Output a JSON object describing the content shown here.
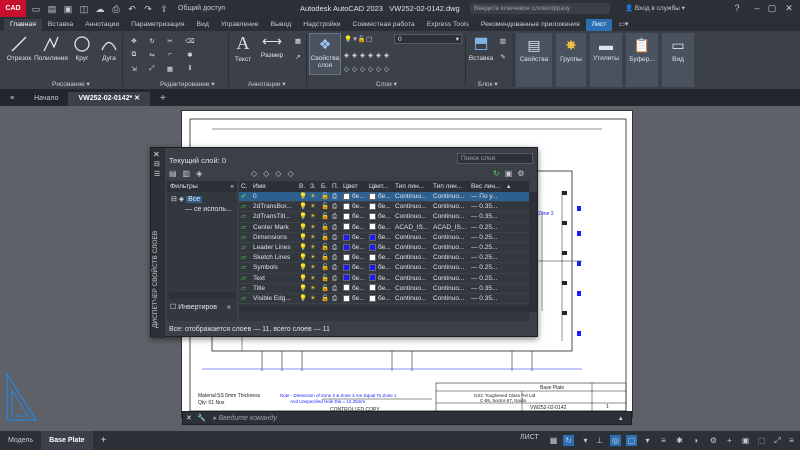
{
  "titlebar": {
    "app_badge": "CAD",
    "share_label": "Общий доступ",
    "title": "Autodesk AutoCAD 2023",
    "filename": "VW252-02-0142.dwg",
    "search_placeholder": "Введите ключевое слово/фразу",
    "sign_in": "Вход в службы"
  },
  "ribbon_tabs": [
    "Главная",
    "Вставка",
    "Аннотации",
    "Параметризация",
    "Вид",
    "Управление",
    "Вывод",
    "Надстройки",
    "Совместная работа",
    "Express Tools",
    "Рекомендованные приложения",
    "Лист"
  ],
  "ribbon": {
    "draw_tools": [
      "Отрезок",
      "Полилиния",
      "Круг",
      "Дуга"
    ],
    "panel_draw": "Рисование ▾",
    "panel_modify": "Редактирование ▾",
    "text_tool": "Текст",
    "dim_tool": "Размер",
    "panel_annot": "Аннотации ▾",
    "layer_props": "Свойства слоя",
    "layer_combo": "0",
    "panel_layers": "Слои ▾",
    "insert_tool": "Вставка",
    "panel_block": "Блок ▾",
    "props_tool": "Свойства",
    "groups_tool": "Группы",
    "utils_tool": "Утилиты",
    "clipboard_tool": "Буфер...",
    "view_tool": "Вид"
  },
  "file_tabs": {
    "start": "Начало",
    "file": "VW252-02-0142*"
  },
  "palette": {
    "side_title": "ДИСПЕТЧЕР СВОЙСТВ СЛОЕВ",
    "current_layer": "Текущий слой: 0",
    "search_placeholder": "Поиск слоя",
    "filters_label": "Фильтры",
    "filter_all": "Все",
    "filter_used": "се исполь...",
    "invert_label": "Инвертиров",
    "columns": [
      "С.",
      "Имя",
      "В.",
      "З.",
      "Б.",
      "П.",
      "Цвет",
      "Цвет...",
      "Тип лин...",
      "Тип лин...",
      "Вес лин..."
    ],
    "rows": [
      {
        "name": "0",
        "color": "бе...",
        "linetype": "Continuo...",
        "linetype2": "Continuo...",
        "weight": "— По у...",
        "swatch": "#ffffff",
        "swatch2": "#ffffff"
      },
      {
        "name": "2dTransBor...",
        "color": "бе...",
        "linetype": "Continuo...",
        "linetype2": "Continuo...",
        "weight": "— 0.35...",
        "swatch": "#ffffff",
        "swatch2": "#ffffff"
      },
      {
        "name": "2dTransTitl...",
        "color": "бе...",
        "linetype": "Continuo...",
        "linetype2": "Continuo...",
        "weight": "— 0.35...",
        "swatch": "#ffffff",
        "swatch2": "#ffffff"
      },
      {
        "name": "Center Mark",
        "color": "бе...",
        "linetype": "ACAD_IS...",
        "linetype2": "ACAD_IS...",
        "weight": "— 0.25...",
        "swatch": "#ffffff",
        "swatch2": "#ffffff"
      },
      {
        "name": "Dimensions",
        "color": "бе...",
        "linetype": "Continuo...",
        "linetype2": "Continuo...",
        "weight": "— 0.25...",
        "swatch": "#1a1aff",
        "swatch2": "#1a1aff"
      },
      {
        "name": "Leader Lines",
        "color": "бе...",
        "linetype": "Continuo...",
        "linetype2": "Continuo...",
        "weight": "— 0.25...",
        "swatch": "#1a1aff",
        "swatch2": "#1a1aff"
      },
      {
        "name": "Sketch Lines",
        "color": "бе...",
        "linetype": "Continuo...",
        "linetype2": "Continuo...",
        "weight": "— 0.25...",
        "swatch": "#ffffff",
        "swatch2": "#ffffff"
      },
      {
        "name": "Symbols",
        "color": "бе...",
        "linetype": "Continuo...",
        "linetype2": "Continuo...",
        "weight": "— 0.25...",
        "swatch": "#1a1aff",
        "swatch2": "#1a1aff"
      },
      {
        "name": "Text",
        "color": "бе...",
        "linetype": "Continuo...",
        "linetype2": "Continuo...",
        "weight": "— 0.25...",
        "swatch": "#1a1aff",
        "swatch2": "#1a1aff"
      },
      {
        "name": "Title",
        "color": "бе...",
        "linetype": "Continuo...",
        "linetype2": "Continuo...",
        "weight": "— 0.35...",
        "swatch": "#ffffff",
        "swatch2": "#ffffff"
      },
      {
        "name": "Visible Edg...",
        "color": "бе...",
        "linetype": "Continuo...",
        "linetype2": "Continuo...",
        "weight": "— 0.35...",
        "swatch": "#ffffff",
        "swatch2": "#ffffff"
      }
    ],
    "status": "Все: отображается слоев — 11, всего слоев — 11"
  },
  "drawing": {
    "title_block_name": "Base Plate",
    "company": "GSC Toughened Glass Pvt Ltd",
    "address": "C-59, Sector-57, Noida",
    "drawing_no": "VW252-02-0142",
    "controlled": "CONTROLLED COPY",
    "material": "Material:SS 6mm Thickness",
    "qty": "Qty: 01 Nos",
    "note": "Note - Dimension of Zone 2 & Zone 3 Are Equal To Zone 1",
    "note2": "And Unspecified Hole Dia = 12.25mm",
    "zone_label": "Zone 3",
    "sheet_no": "1"
  },
  "command": {
    "placeholder": "Введите команду"
  },
  "statusbar": {
    "model_tab": "Модель",
    "layout_tab": "Base Plate",
    "sheet_label": "ЛИСТ"
  },
  "colors": {
    "accent": "#2d6fb3",
    "app_red": "#c8102e",
    "ribbon_bg": "#3b4049",
    "palette_bg": "#3b3f46"
  }
}
